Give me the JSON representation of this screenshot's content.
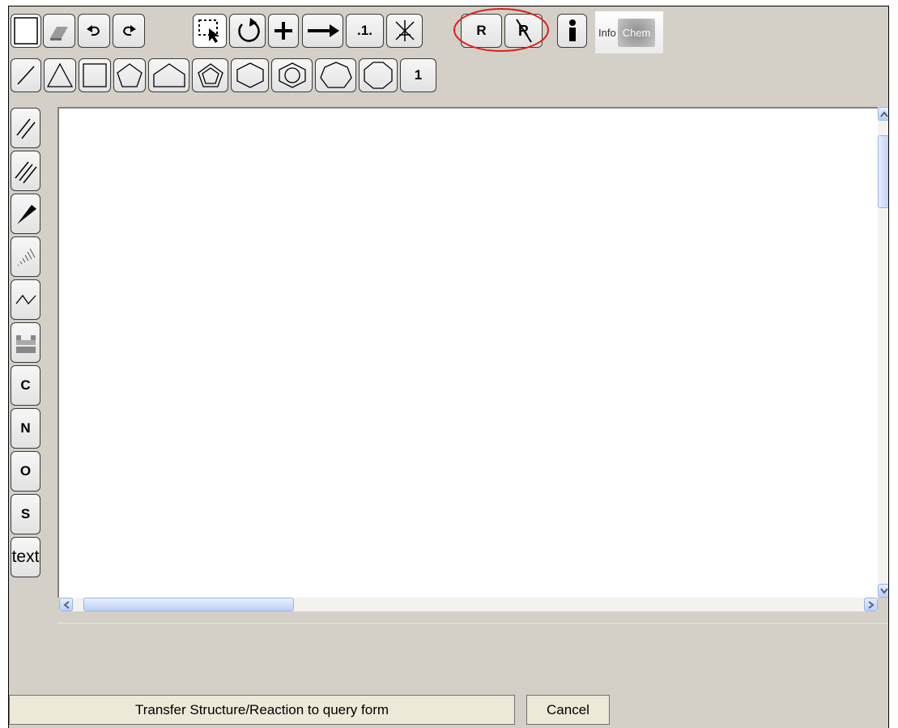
{
  "toolbar": {
    "row1": [
      {
        "name": "new-page-button",
        "icon": "blank-page-icon"
      },
      {
        "name": "eraser-button",
        "icon": "eraser-icon"
      },
      {
        "name": "undo-button",
        "icon": "undo-icon"
      },
      {
        "name": "redo-button",
        "icon": "redo-icon"
      },
      {
        "name": "lasso-select-button",
        "icon": "lasso-select-icon"
      },
      {
        "name": "rotate-button",
        "icon": "rotate-icon"
      },
      {
        "name": "add-charge-button",
        "icon": "plus-icon"
      },
      {
        "name": "reaction-arrow-button",
        "icon": "reaction-arrow-icon"
      },
      {
        "name": "atom-map-button",
        "label": ".1."
      },
      {
        "name": "remove-atom-map-button",
        "icon": "crossed-atom-icon"
      },
      {
        "name": "r-group-button",
        "label": "R"
      },
      {
        "name": "remove-r-group-button",
        "label": "R"
      },
      {
        "name": "info-button",
        "icon": "info-icon"
      }
    ],
    "row2": [
      {
        "name": "single-bond-button",
        "icon": "single-bond-icon"
      },
      {
        "name": "ring-3-button",
        "icon": "triangle-ring-icon"
      },
      {
        "name": "ring-4-button",
        "icon": "square-ring-icon"
      },
      {
        "name": "ring-5-button",
        "icon": "pentagon-ring-icon"
      },
      {
        "name": "ring-5-open-button",
        "icon": "pentagon-open-ring-icon"
      },
      {
        "name": "ring-5-aromatic-button",
        "icon": "aromatic-pentagon-icon"
      },
      {
        "name": "ring-6-button",
        "icon": "hexagon-ring-icon"
      },
      {
        "name": "benzene-button",
        "icon": "benzene-icon"
      },
      {
        "name": "ring-7-button",
        "icon": "heptagon-ring-icon"
      },
      {
        "name": "ring-8-button",
        "icon": "octagon-ring-icon"
      },
      {
        "name": "ring-count-button",
        "label": "1"
      }
    ],
    "left": [
      {
        "name": "double-bond-button",
        "icon": "double-bond-icon"
      },
      {
        "name": "triple-bond-button",
        "icon": "triple-bond-icon"
      },
      {
        "name": "wedge-bond-button",
        "icon": "wedge-bond-icon"
      },
      {
        "name": "hashed-bond-button",
        "icon": "hashed-bond-icon"
      },
      {
        "name": "chain-button",
        "icon": "chain-icon"
      },
      {
        "name": "template-button",
        "icon": "template-icon"
      },
      {
        "name": "atom-c-button",
        "label": "C"
      },
      {
        "name": "atom-n-button",
        "label": "N"
      },
      {
        "name": "atom-o-button",
        "label": "O"
      },
      {
        "name": "atom-s-button",
        "label": "S"
      },
      {
        "name": "text-button",
        "label": "text"
      }
    ]
  },
  "logo": {
    "part1": "Info",
    "part2": "Chem"
  },
  "highlight_color": "#e0201a",
  "buttons": {
    "transfer": "Transfer Structure/Reaction to query form",
    "cancel": "Cancel"
  }
}
